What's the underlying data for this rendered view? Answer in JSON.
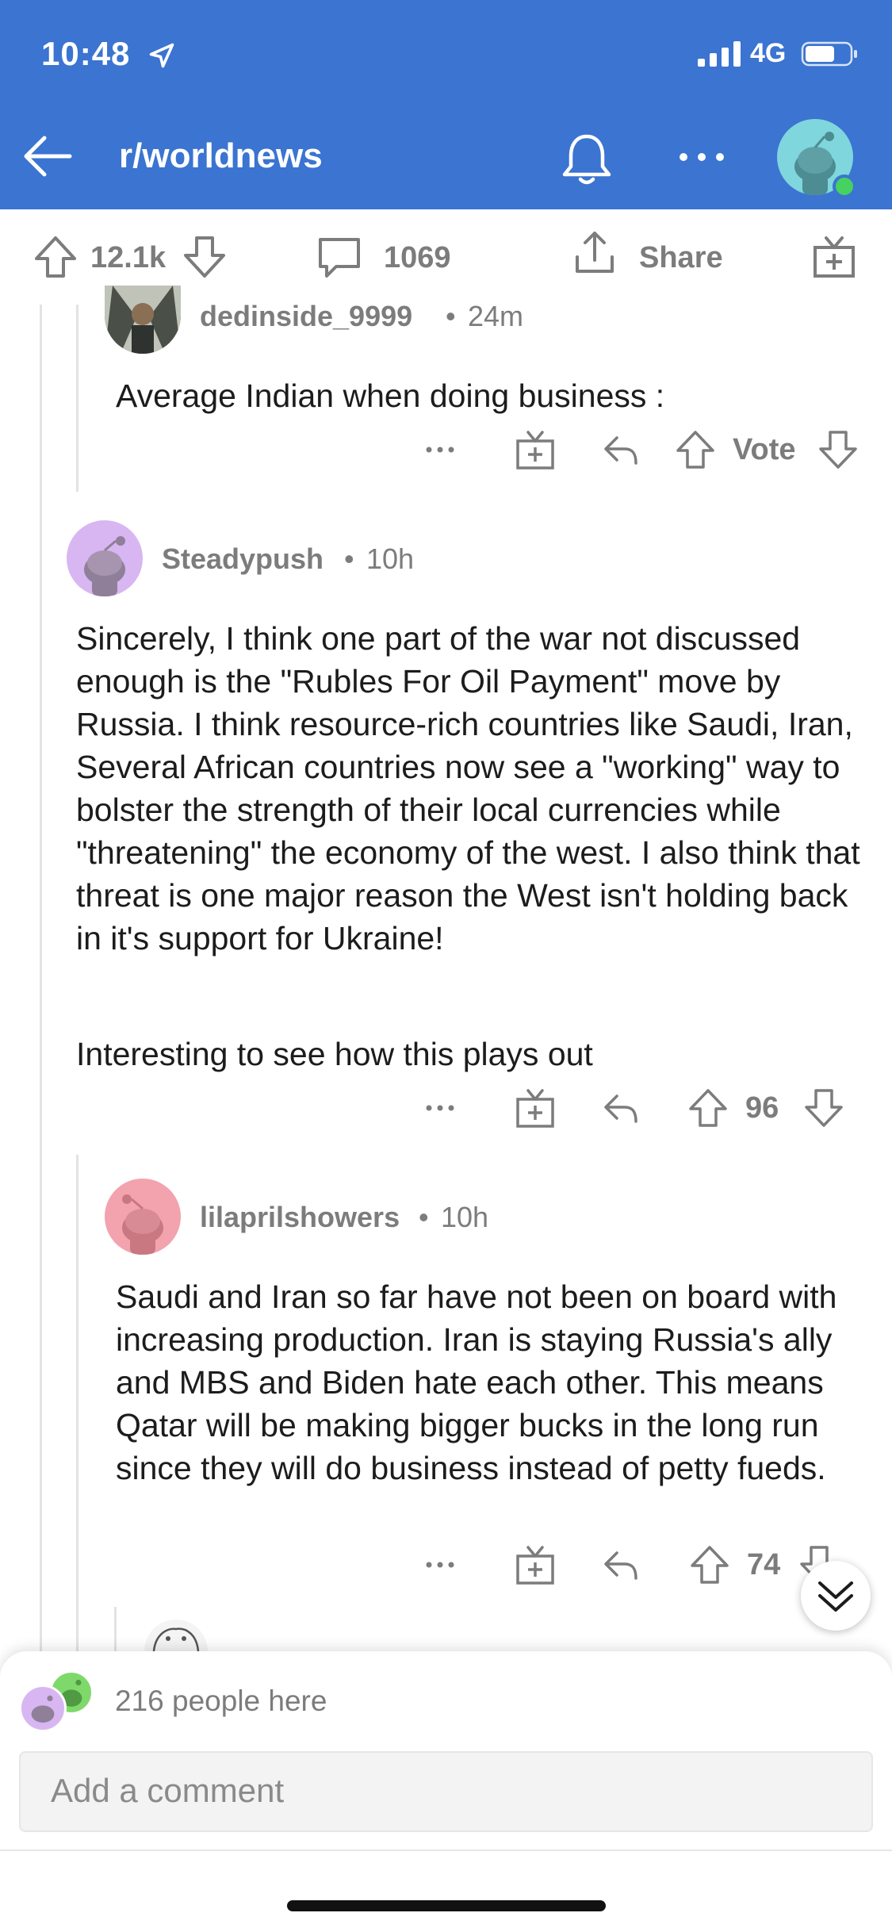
{
  "status": {
    "time": "10:48",
    "network": "4G"
  },
  "header": {
    "subreddit": "r/worldnews"
  },
  "post_bar": {
    "upvotes": "12.1k",
    "comments": "1069",
    "share_label": "Share"
  },
  "comments": [
    {
      "author": "dedinside_9999",
      "age": "24m",
      "body": "Average Indian when doing business :",
      "score": "Vote"
    },
    {
      "author": "Steadypush",
      "age": "10h",
      "body_p1": "Sincerely, I think one part of the war not discussed enough is the \"Rubles For Oil Payment\" move by Russia. I think resource-rich countries like Saudi, Iran, Several African countries now see a \"working\" way to bolster the strength of their local currencies while \"threatening\" the economy of the west. I also think that threat is one major reason the West isn't holding back in it's support for Ukraine!",
      "body_p2": "Interesting to see how this plays out",
      "score": "96"
    },
    {
      "author": "lilaprilshowers",
      "age": "10h",
      "body": "Saudi and Iran so far have not been on board with increasing production. Iran is staying Russia's ally and MBS and Biden hate each other. This means Qatar will be making bigger bucks in the long run since they will do business instead of petty fueds.",
      "score": "74"
    }
  ],
  "meta_sep": "•",
  "bottom": {
    "people_here": "216 people here",
    "comment_placeholder": "Add a comment"
  },
  "colors": {
    "header_bg": "#3b74d1",
    "meta_gray": "#7c7c7c",
    "thread_line": "#e3e3e3",
    "online": "#46d160"
  },
  "icons": [
    "send-arrow-icon",
    "back-arrow-icon",
    "bell-icon",
    "more-icon",
    "upvote-icon",
    "downvote-icon",
    "comment-icon",
    "share-icon",
    "gift-icon",
    "reply-icon",
    "chevrons-down-icon"
  ]
}
